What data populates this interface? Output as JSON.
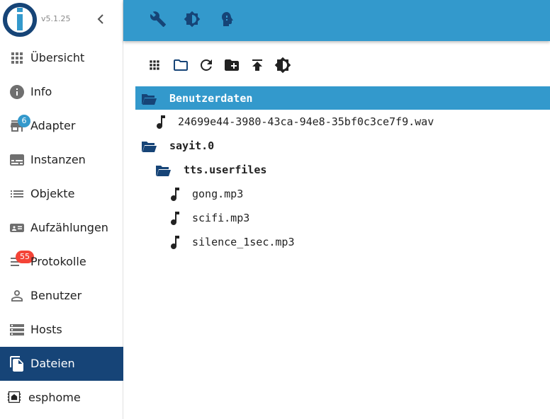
{
  "app": {
    "version": "v5.1.25",
    "accent": "#3399cc",
    "dark": "#164477"
  },
  "sidebar": {
    "items": [
      {
        "label": "Übersicht",
        "icon": "apps-icon"
      },
      {
        "label": "Info",
        "icon": "info-icon"
      },
      {
        "label": "Adapter",
        "icon": "store-icon",
        "badge": "6"
      },
      {
        "label": "Instanzen",
        "icon": "subtitles-icon"
      },
      {
        "label": "Objekte",
        "icon": "list-icon"
      },
      {
        "label": "Aufzählungen",
        "icon": "contact-card-icon"
      },
      {
        "label": "Protokolle",
        "icon": "notes-icon",
        "badge": "55"
      },
      {
        "label": "Benutzer",
        "icon": "person-icon"
      },
      {
        "label": "Hosts",
        "icon": "storage-icon"
      },
      {
        "label": "Dateien",
        "icon": "file-copy-icon",
        "active": true
      },
      {
        "label": "esphome",
        "icon": "esphome-icon"
      }
    ]
  },
  "topbar": {
    "icons": [
      "wrench-icon",
      "brightness-icon",
      "expert-mode-icon"
    ]
  },
  "toolbar": {
    "icons": [
      "grid-view-icon",
      "folder-icon",
      "refresh-icon",
      "create-folder-icon",
      "upload-icon",
      "brightness-icon"
    ]
  },
  "tree": {
    "rows": [
      {
        "name": "Benutzerdaten",
        "type": "folder"
      },
      {
        "name": "24699e44-3980-43ca-94e8-35bf0c3ce7f9.wav",
        "type": "file"
      },
      {
        "name": "sayit.0",
        "type": "folder"
      },
      {
        "name": "tts.userfiles",
        "type": "folder"
      },
      {
        "name": "gong.mp3",
        "type": "file"
      },
      {
        "name": "scifi.mp3",
        "type": "file"
      },
      {
        "name": "silence_1sec.mp3",
        "type": "file"
      }
    ]
  }
}
